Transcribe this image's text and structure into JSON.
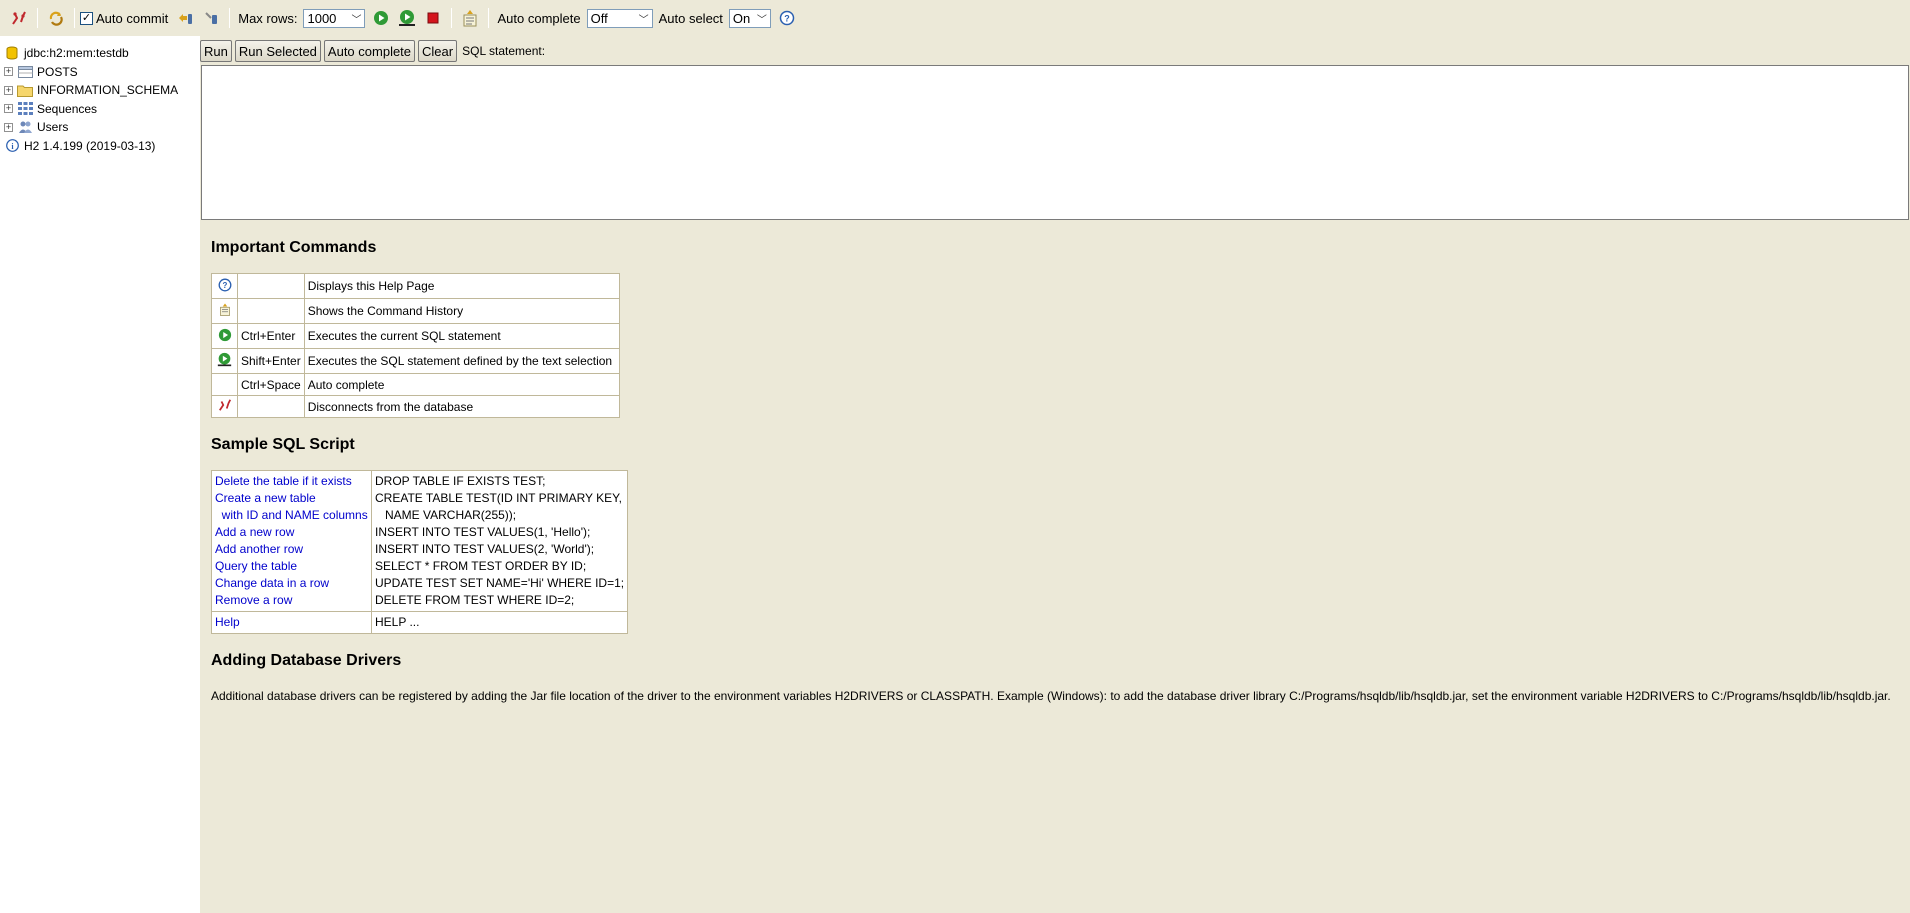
{
  "toolbar": {
    "auto_commit_label": "Auto commit",
    "auto_commit_checked": "✓",
    "max_rows_label": "Max rows:",
    "max_rows_value": "1000",
    "auto_complete_label": "Auto complete",
    "auto_complete_value": "Off",
    "auto_select_label": "Auto select",
    "auto_select_value": "On"
  },
  "tree": {
    "connection": "jdbc:h2:mem:testdb",
    "items": [
      {
        "label": "POSTS",
        "icon": "table-icon"
      },
      {
        "label": "INFORMATION_SCHEMA",
        "icon": "folder-icon"
      },
      {
        "label": "Sequences",
        "icon": "sequences-icon"
      },
      {
        "label": "Users",
        "icon": "users-icon"
      }
    ],
    "version": "H2 1.4.199 (2019-03-13)"
  },
  "query": {
    "run_label": "Run",
    "run_selected_label": "Run Selected",
    "auto_complete_label": "Auto complete",
    "clear_label": "Clear",
    "sql_label": "SQL statement:"
  },
  "help": {
    "important_title": "Important Commands",
    "commands": [
      {
        "icon": "help-icon",
        "key": "",
        "desc": "Displays this Help Page"
      },
      {
        "icon": "history-icon",
        "key": "",
        "desc": "Shows the Command History"
      },
      {
        "icon": "run-icon",
        "key": "Ctrl+Enter",
        "desc": "Executes the current SQL statement"
      },
      {
        "icon": "run-selected-icon",
        "key": "Shift+Enter",
        "desc": "Executes the SQL statement defined by the text selection"
      },
      {
        "icon": "",
        "key": "Ctrl+Space",
        "desc": "Auto complete"
      },
      {
        "icon": "disconnect-icon",
        "key": "",
        "desc": "Disconnects from the database"
      }
    ],
    "sample_title": "Sample SQL Script",
    "sample_links": [
      "Delete the table if it exists",
      "Create a new table",
      "  with ID and NAME columns",
      "Add a new row",
      "Add another row",
      "Query the table",
      "Change data in a row",
      "Remove a row"
    ],
    "sample_code": [
      "DROP TABLE IF EXISTS TEST;",
      "CREATE TABLE TEST(ID INT PRIMARY KEY,",
      "   NAME VARCHAR(255));",
      "INSERT INTO TEST VALUES(1, 'Hello');",
      "INSERT INTO TEST VALUES(2, 'World');",
      "SELECT * FROM TEST ORDER BY ID;",
      "UPDATE TEST SET NAME='Hi' WHERE ID=1;",
      "DELETE FROM TEST WHERE ID=2;"
    ],
    "help_link": "Help",
    "help_code": "HELP ...",
    "drivers_title": "Adding Database Drivers",
    "drivers_text": "Additional database drivers can be registered by adding the Jar file location of the driver to the environment variables H2DRIVERS or CLASSPATH. Example (Windows): to add the database driver library C:/Programs/hsqldb/lib/hsqldb.jar, set the environment variable H2DRIVERS to C:/Programs/hsqldb/lib/hsqldb.jar."
  }
}
